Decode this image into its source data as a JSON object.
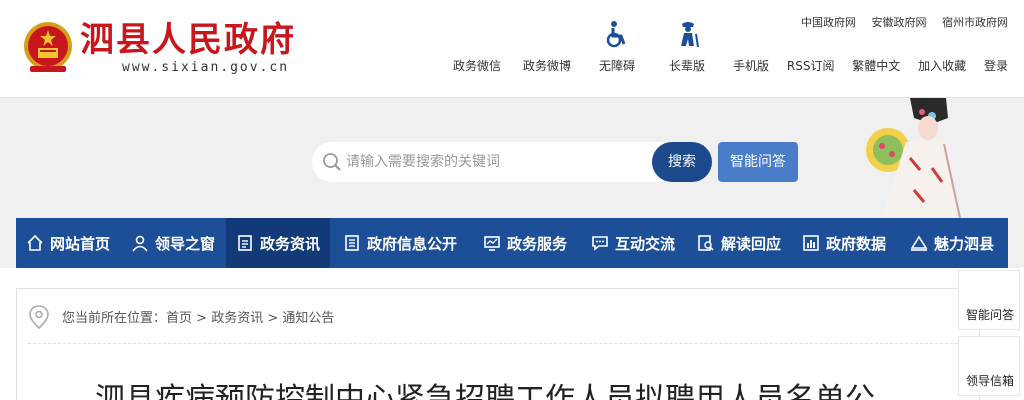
{
  "header": {
    "site_title": "泗县人民政府",
    "site_url": "www.sixian.gov.cn",
    "quick_links": [
      {
        "label": "政务微信",
        "icon": "wechat-icon"
      },
      {
        "label": "政务微博",
        "icon": "weibo-icon"
      },
      {
        "label": "无障碍",
        "icon": "wheelchair-icon"
      },
      {
        "label": "长辈版",
        "icon": "elder-icon"
      }
    ],
    "top_links": [
      "中国政府网",
      "安徽政府网",
      "宿州市政府网"
    ],
    "util_links": [
      "手机版",
      "RSS订阅",
      "繁體中文",
      "加入收藏",
      "登录"
    ]
  },
  "search": {
    "placeholder": "请输入需要搜索的关键词",
    "button_label": "搜索",
    "qa_button_label": "智能问答"
  },
  "nav": {
    "items": [
      {
        "label": "网站首页",
        "icon": "home-icon"
      },
      {
        "label": "领导之窗",
        "icon": "user-icon"
      },
      {
        "label": "政务资讯",
        "icon": "document-icon",
        "active": true
      },
      {
        "label": "政府信息公开",
        "icon": "list-icon"
      },
      {
        "label": "政务服务",
        "icon": "chart-monitor-icon"
      },
      {
        "label": "互动交流",
        "icon": "chat-icon"
      },
      {
        "label": "解读回应",
        "icon": "search-doc-icon"
      },
      {
        "label": "政府数据",
        "icon": "bar-chart-icon"
      },
      {
        "label": "魅力泗县",
        "icon": "mountain-icon"
      }
    ]
  },
  "breadcrumb": {
    "prefix": "您当前所在位置：",
    "items": [
      "首页",
      "政务资讯",
      "通知公告"
    ],
    "separator": " > "
  },
  "article": {
    "title": "泗县疾病预防控制中心紧急招聘工作人员拟聘用人员名单公"
  },
  "float_panel": {
    "items": [
      "智能问答",
      "领导信箱"
    ]
  },
  "colors": {
    "brand_red": "#c8161d",
    "nav_blue": "#1d4f98",
    "nav_active": "#123a78",
    "search_button": "#1c4a8c",
    "qa_button": "#4a7dc9"
  }
}
